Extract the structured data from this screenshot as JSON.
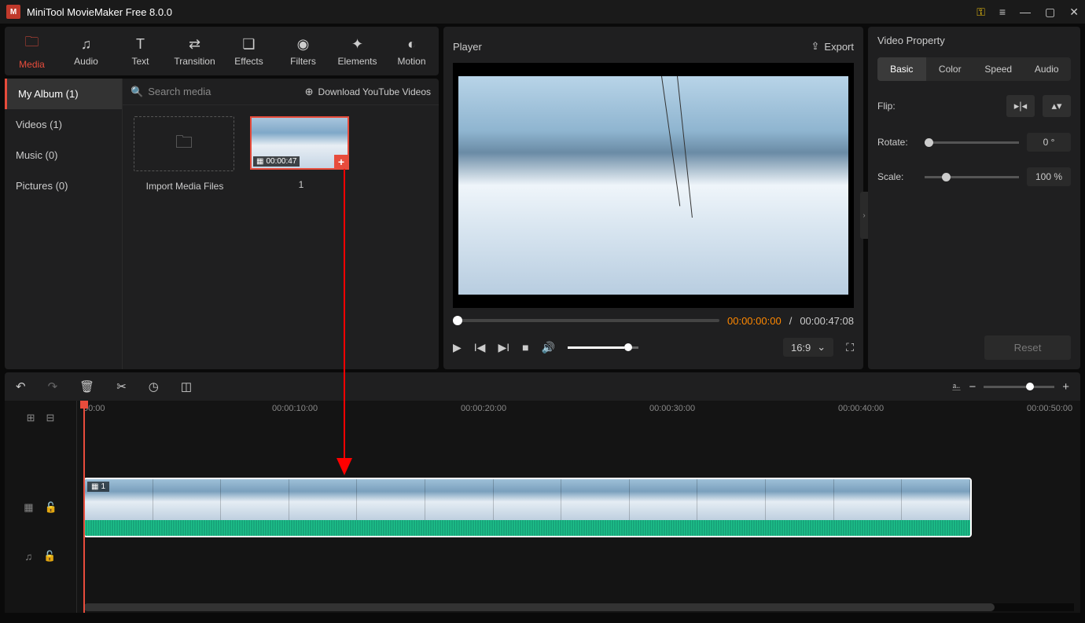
{
  "app": {
    "title": "MiniTool MovieMaker Free 8.0.0"
  },
  "toolbar": {
    "media": "Media",
    "audio": "Audio",
    "text": "Text",
    "transition": "Transition",
    "effects": "Effects",
    "filters": "Filters",
    "elements": "Elements",
    "motion": "Motion"
  },
  "sidebar": {
    "album": "My Album (1)",
    "videos": "Videos (1)",
    "music": "Music (0)",
    "pictures": "Pictures (0)"
  },
  "media": {
    "search_placeholder": "Search media",
    "youtube": "Download YouTube Videos",
    "import_label": "Import Media Files",
    "clip_duration": "00:00:47",
    "clip_index": "1"
  },
  "player": {
    "title": "Player",
    "export": "Export",
    "current": "00:00:00:00",
    "total": "00:00:47:08",
    "sep": " / ",
    "aspect": "16:9"
  },
  "properties": {
    "title": "Video Property",
    "tabs": {
      "basic": "Basic",
      "color": "Color",
      "speed": "Speed",
      "audio": "Audio"
    },
    "flip": "Flip:",
    "rotate": "Rotate:",
    "rotate_val": "0 °",
    "scale": "Scale:",
    "scale_val": "100 %",
    "reset": "Reset"
  },
  "timeline": {
    "ruler": [
      "00:00",
      "00:00:10:00",
      "00:00:20:00",
      "00:00:30:00",
      "00:00:40:00",
      "00:00:50:00"
    ],
    "clip_index": "1"
  }
}
